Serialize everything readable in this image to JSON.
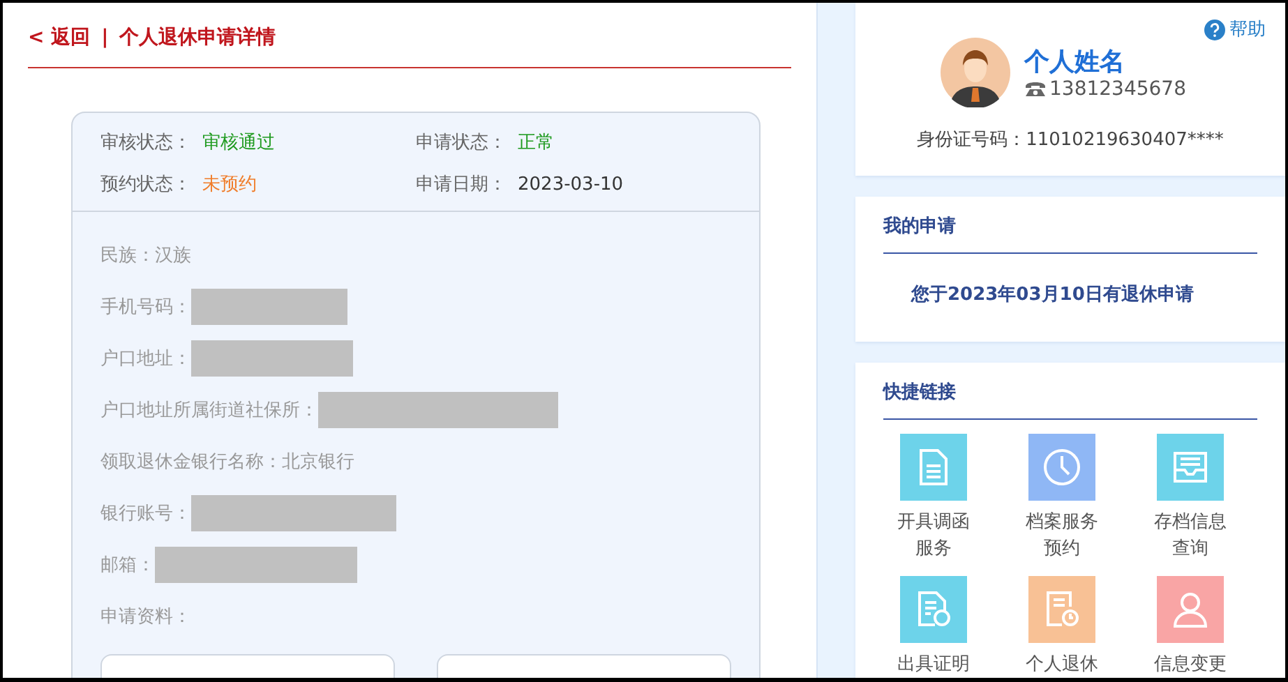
{
  "header": {
    "back": "< 返回",
    "separator": "|",
    "title": "个人退休申请详情"
  },
  "status": [
    {
      "label": "审核状态：",
      "value": "审核通过",
      "color": "#1e9a1e"
    },
    {
      "label": "申请状态：",
      "value": "正常",
      "color": "#1e9a1e"
    },
    {
      "label": "预约状态：",
      "value": "未预约",
      "color": "#f07d2a"
    },
    {
      "label": "申请日期：",
      "value": "2023-03-10",
      "color": "#333333"
    }
  ],
  "fields": [
    {
      "kind": "text",
      "label": "民族：汉族"
    },
    {
      "kind": "masked",
      "label": "手机号码："
    },
    {
      "kind": "masked",
      "label": "户口地址："
    },
    {
      "kind": "masked",
      "label": "户口地址所属街道社保所："
    },
    {
      "kind": "text",
      "label": "领取退休金银行名称：北京银行"
    },
    {
      "kind": "masked",
      "label": "银行账号："
    },
    {
      "kind": "masked",
      "label": "邮箱："
    },
    {
      "kind": "text",
      "label": "申请资料："
    }
  ],
  "profile": {
    "help": "帮助",
    "name": "个人姓名",
    "phone": "13812345678",
    "id_line": "身份证号码：11010219630407****"
  },
  "my_application": {
    "title": "我的申请",
    "text": "您于2023年03月10日有退休申请"
  },
  "quick_links": {
    "title": "快捷链接",
    "items": [
      {
        "label": "开具调函服务",
        "kind": "document",
        "color": "#6dd3ea"
      },
      {
        "label": "档案服务预约",
        "kind": "clock",
        "color": "#8fb7f5"
      },
      {
        "label": "存档信息查询",
        "kind": "tray",
        "color": "#6dd3ea"
      },
      {
        "label": "出具证明",
        "kind": "certificate",
        "color": "#6dd3ea"
      },
      {
        "label": "个人退休",
        "kind": "reminder",
        "color": "#f8c195"
      },
      {
        "label": "信息变更",
        "kind": "person",
        "color": "#f9a5a5"
      }
    ]
  }
}
